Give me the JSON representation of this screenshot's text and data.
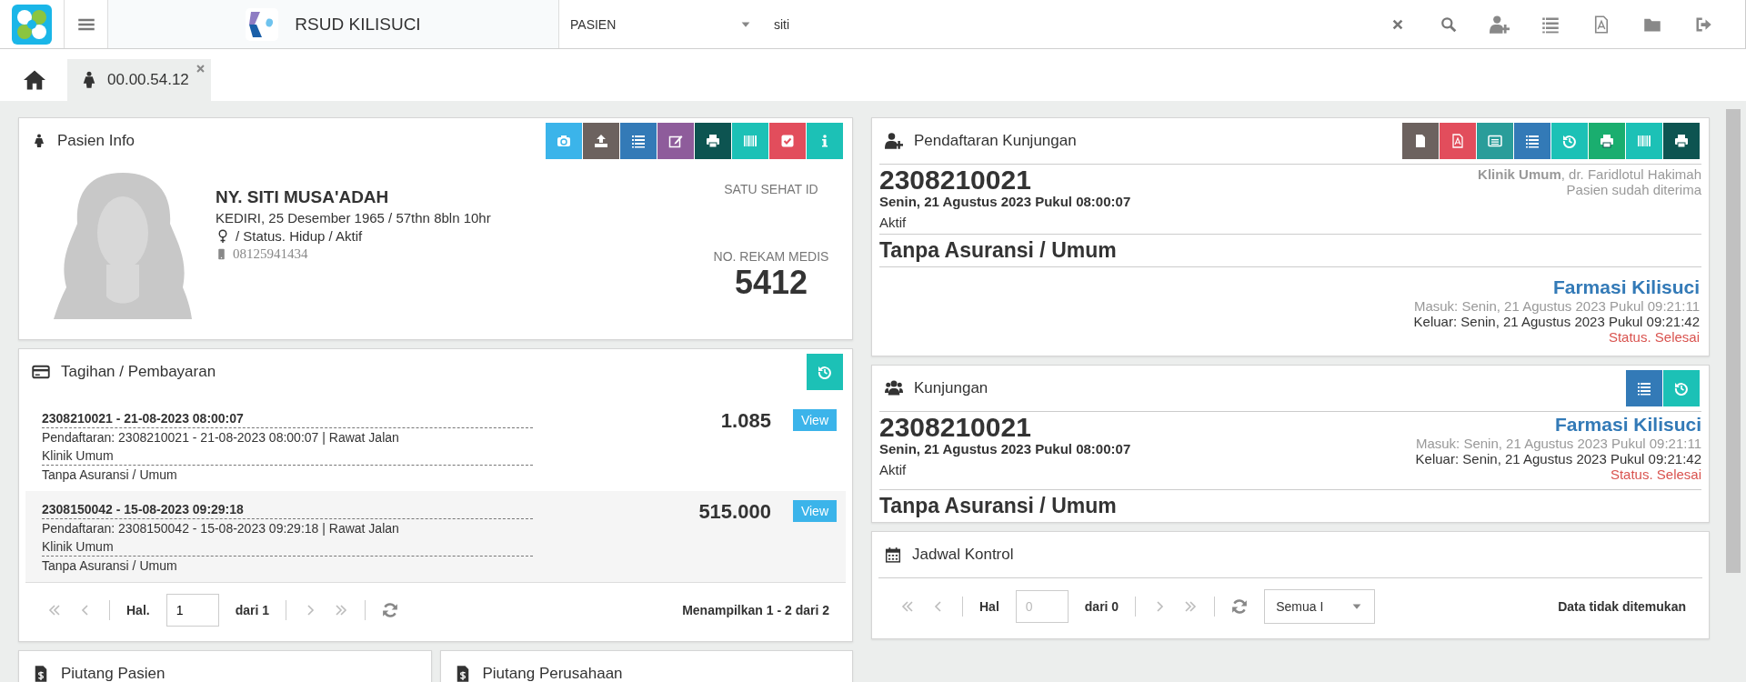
{
  "header": {
    "app_title": "RSUD KILISUCI",
    "search_category": "PASIEN",
    "search_value": "siti"
  },
  "tabs": [
    {
      "kind": "home",
      "selected": false
    },
    {
      "kind": "patient",
      "label": "00.00.54.12",
      "selected": true
    }
  ],
  "patient_info": {
    "title": "Pasien Info",
    "name": "NY. SITI MUSA'ADAH",
    "birth": "KEDIRI, 25 Desember 1965 / 57thn 8bln 10hr",
    "status": "/ Status. Hidup / Aktif",
    "phone": "08125941434",
    "satu_sehat_label": "SATU SEHAT ID",
    "rm_label": "NO. REKAM MEDIS",
    "rm_number": "5412"
  },
  "billing": {
    "title": "Tagihan / Pembayaran",
    "rows": [
      {
        "header": "2308210021 - 21-08-2023 08:00:07",
        "registration": "Pendaftaran: 2308210021 - 21-08-2023 08:00:07 | Rawat Jalan",
        "clinic": "Klinik Umum",
        "payer": "Tanpa Asuransi / Umum",
        "amount": "1.085",
        "button": "View"
      },
      {
        "header": "2308150042 - 15-08-2023 09:29:18",
        "registration": "Pendaftaran: 2308150042 - 15-08-2023 09:29:18 | Rawat Jalan",
        "clinic": "Klinik Umum",
        "payer": "Tanpa Asuransi / Umum",
        "amount": "515.000",
        "button": "View"
      }
    ],
    "pager": {
      "page_label": "Hal.",
      "page_value": "1",
      "page_of": "dari 1",
      "summary": "Menampilkan 1 - 2 dari 2"
    }
  },
  "receivables": [
    {
      "title": "Piutang Pasien"
    },
    {
      "title": "Piutang Perusahaan"
    }
  ],
  "registration": {
    "title": "Pendaftaran Kunjungan",
    "number": "2308210021",
    "date": "Senin, 21 Agustus 2023 Pukul 08:00:07",
    "status": "Aktif",
    "clinic": "**Klinik Umum**, dr. Faridlotul Hakimah",
    "note": "Pasien sudah diterima",
    "payer": "Tanpa Asuransi / Umum",
    "unit": "Farmasi Kilisuci",
    "entry": "Masuk: Senin, 21 Agustus 2023 Pukul 09:21:11",
    "exit": "Keluar: Senin, 21 Agustus 2023 Pukul 09:21:42",
    "unit_status": "Status. Selesai"
  },
  "visit": {
    "title": "Kunjungan",
    "number": "2308210021",
    "date": "Senin, 21 Agustus 2023 Pukul 08:00:07",
    "status": "Aktif",
    "unit": "Farmasi Kilisuci",
    "entry": "Masuk: Senin, 21 Agustus 2023 Pukul 09:21:11",
    "exit": "Keluar: Senin, 21 Agustus 2023 Pukul 09:21:42",
    "unit_status": "Status. Selesai",
    "payer": "Tanpa Asuransi / Umum"
  },
  "schedule": {
    "title": "Jadwal Kontrol",
    "page_label": "Hal",
    "page_placeholder": "0",
    "page_of": "dari 0",
    "filter": "Semua I",
    "summary": "Data tidak ditemukan"
  }
}
